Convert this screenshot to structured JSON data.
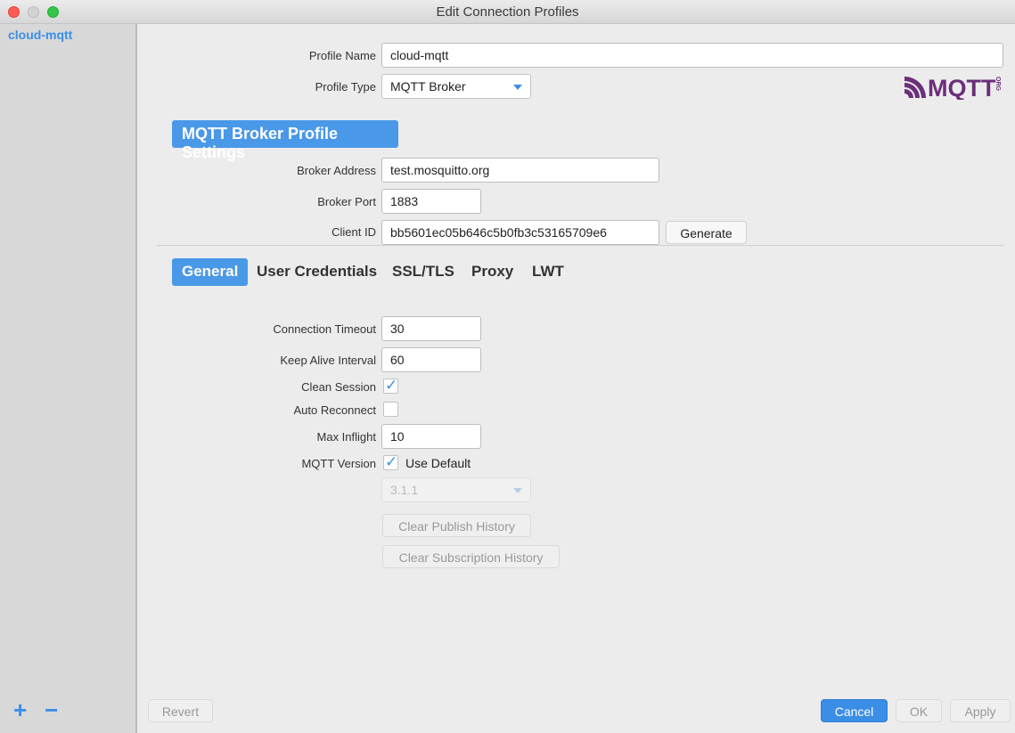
{
  "window": {
    "title": "Edit Connection Profiles"
  },
  "sidebar": {
    "profiles": [
      "cloud-mqtt"
    ],
    "add_label": "+",
    "remove_label": "−"
  },
  "profile": {
    "name_label": "Profile Name",
    "name_value": "cloud-mqtt",
    "type_label": "Profile Type",
    "type_value": "MQTT Broker",
    "logo_text": "MQTT",
    "logo_suffix": "ORG"
  },
  "broker": {
    "section_title": "MQTT Broker Profile Settings",
    "address_label": "Broker Address",
    "address_value": "test.mosquitto.org",
    "port_label": "Broker Port",
    "port_value": "1883",
    "client_id_label": "Client ID",
    "client_id_value": "bb5601ec05b646c5b0fb3c53165709e6",
    "generate_label": "Generate"
  },
  "tabs": [
    "General",
    "User Credentials",
    "SSL/TLS",
    "Proxy",
    "LWT"
  ],
  "active_tab": "General",
  "general": {
    "timeout_label": "Connection Timeout",
    "timeout_value": "30",
    "keepalive_label": "Keep Alive Interval",
    "keepalive_value": "60",
    "clean_session_label": "Clean Session",
    "clean_session_checked": true,
    "auto_reconnect_label": "Auto Reconnect",
    "auto_reconnect_checked": false,
    "max_inflight_label": "Max Inflight",
    "max_inflight_value": "10",
    "mqtt_version_label": "MQTT Version",
    "use_default_label": "Use Default",
    "use_default_checked": true,
    "version_value": "3.1.1",
    "clear_publish_label": "Clear Publish History",
    "clear_subscription_label": "Clear Subscription History"
  },
  "footer": {
    "revert_label": "Revert",
    "cancel_label": "Cancel",
    "ok_label": "OK",
    "apply_label": "Apply"
  },
  "colors": {
    "accent": "#4a98e8",
    "logo": "#6b2f7a"
  }
}
